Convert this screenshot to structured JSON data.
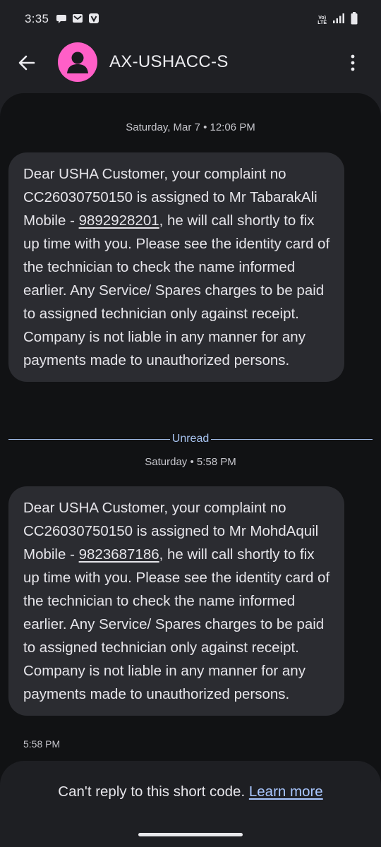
{
  "status_bar": {
    "time": "3:35",
    "volte_top": "Vo)",
    "volte_bottom": "LTE",
    "icons": [
      "chat-bubble-icon",
      "gmail-icon",
      "vi-app-icon",
      "volte-icon",
      "signal-icon",
      "battery-icon"
    ]
  },
  "app_bar": {
    "contact_name": "AX-USHACC-S",
    "avatar_color": "#ff5fc7"
  },
  "messages": [
    {
      "date_header": "Saturday, Mar 7 • 12:06 PM",
      "text_before_phone": "Dear USHA Customer, your complaint no CC26030750150 is assigned to Mr TabarakAli Mobile - ",
      "phone": "9892928201",
      "text_after_phone": ", he will call shortly to fix up time with you. Please see the identity card of the technician to check the name informed earlier. Any Service/ Spares charges to be paid to assigned technician only against receipt. Company is not liable in any manner for any payments made to unauthorized persons."
    },
    {
      "date_header": "Saturday • 5:58 PM",
      "text_before_phone": "Dear USHA Customer, your complaint no CC26030750150 is assigned to Mr MohdAquil Mobile - ",
      "phone": "9823687186",
      "text_after_phone": ", he will call shortly to fix up time with you. Please see the identity card of the technician to check the name informed earlier. Any Service/ Spares charges to be paid to assigned technician only against receipt. Company is not liable in any manner for any payments made to unauthorized persons.",
      "timestamp": "5:58 PM"
    }
  ],
  "unread_label": "Unread",
  "footer": {
    "text": "Can't reply to this short code.",
    "link": "Learn more"
  },
  "colors": {
    "accent": "#a9c7ff",
    "bubble": "#2b2c31",
    "background": "#111214"
  }
}
